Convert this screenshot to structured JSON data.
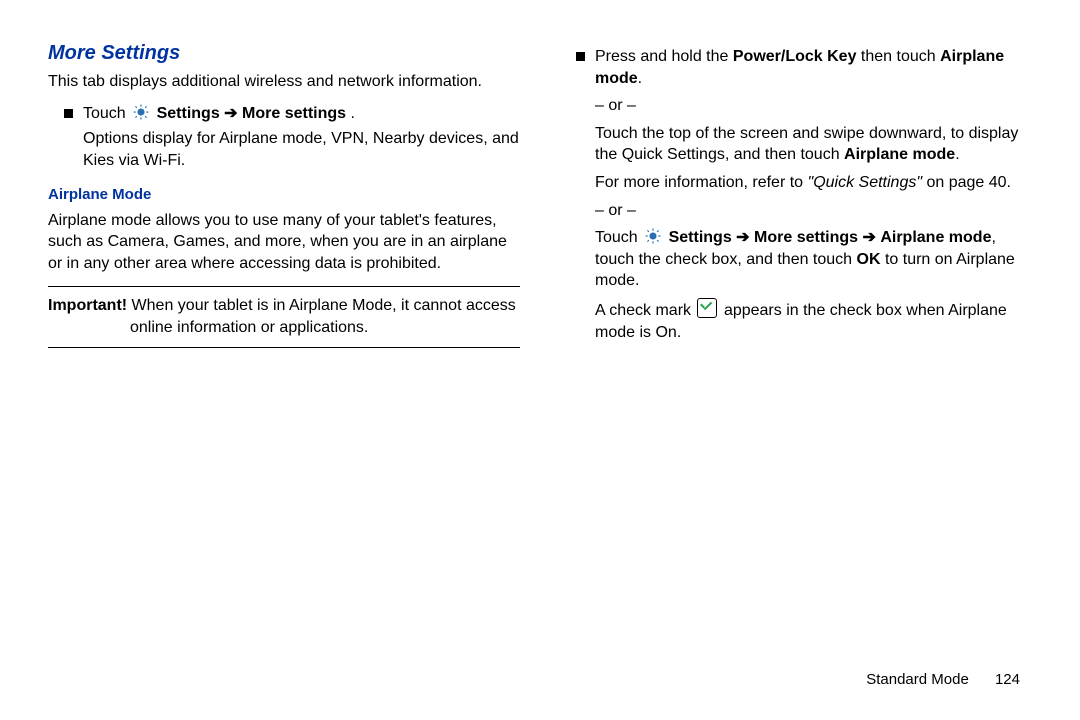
{
  "left": {
    "heading": "More Settings",
    "intro": "This tab displays additional wireless and network information.",
    "bullet_prefix": "Touch ",
    "bullet_path1": "Settings",
    "bullet_arrow": " ➔ ",
    "bullet_path2": "More settings",
    "bullet_end": ".",
    "bullet_line2": "Options display for Airplane mode, VPN, Nearby devices, and Kies via Wi-Fi.",
    "sub": "Airplane Mode",
    "para1": "Airplane mode allows you to use many of your tablet's features, such as Camera, Games, and more, when you are in an airplane or in any other area where accessing data is prohibited.",
    "important_label": "Important!",
    "important_text": " When your tablet is in Airplane Mode, it cannot access online information or applications."
  },
  "right": {
    "b1_pre": "Press and hold the ",
    "b1_key": "Power/Lock Key",
    "b1_mid": " then touch ",
    "b1_mode": "Airplane mode",
    "b1_end": ".",
    "or": "– or –",
    "p2_a": "Touch the top of the screen and swipe downward, to display the Quick Settings, and then touch ",
    "p2_b": "Airplane mode",
    "p2_c": ".",
    "p3_a": "For more information, refer to ",
    "p3_b": "\"Quick Settings\"",
    "p3_c": " on page 40.",
    "p4_pre": "Touch ",
    "p4_s": "Settings",
    "p4_arrow": " ➔ ",
    "p4_ms": "More settings",
    "p4_am": "Airplane mode",
    "p4_mid": ", touch the check box, and then touch ",
    "p4_ok": "OK",
    "p4_end": " to turn on Airplane mode.",
    "p5_a": "A check mark ",
    "p5_b": " appears in the check box when Airplane mode is On."
  },
  "footer": {
    "mode": "Standard Mode",
    "page": "124"
  }
}
